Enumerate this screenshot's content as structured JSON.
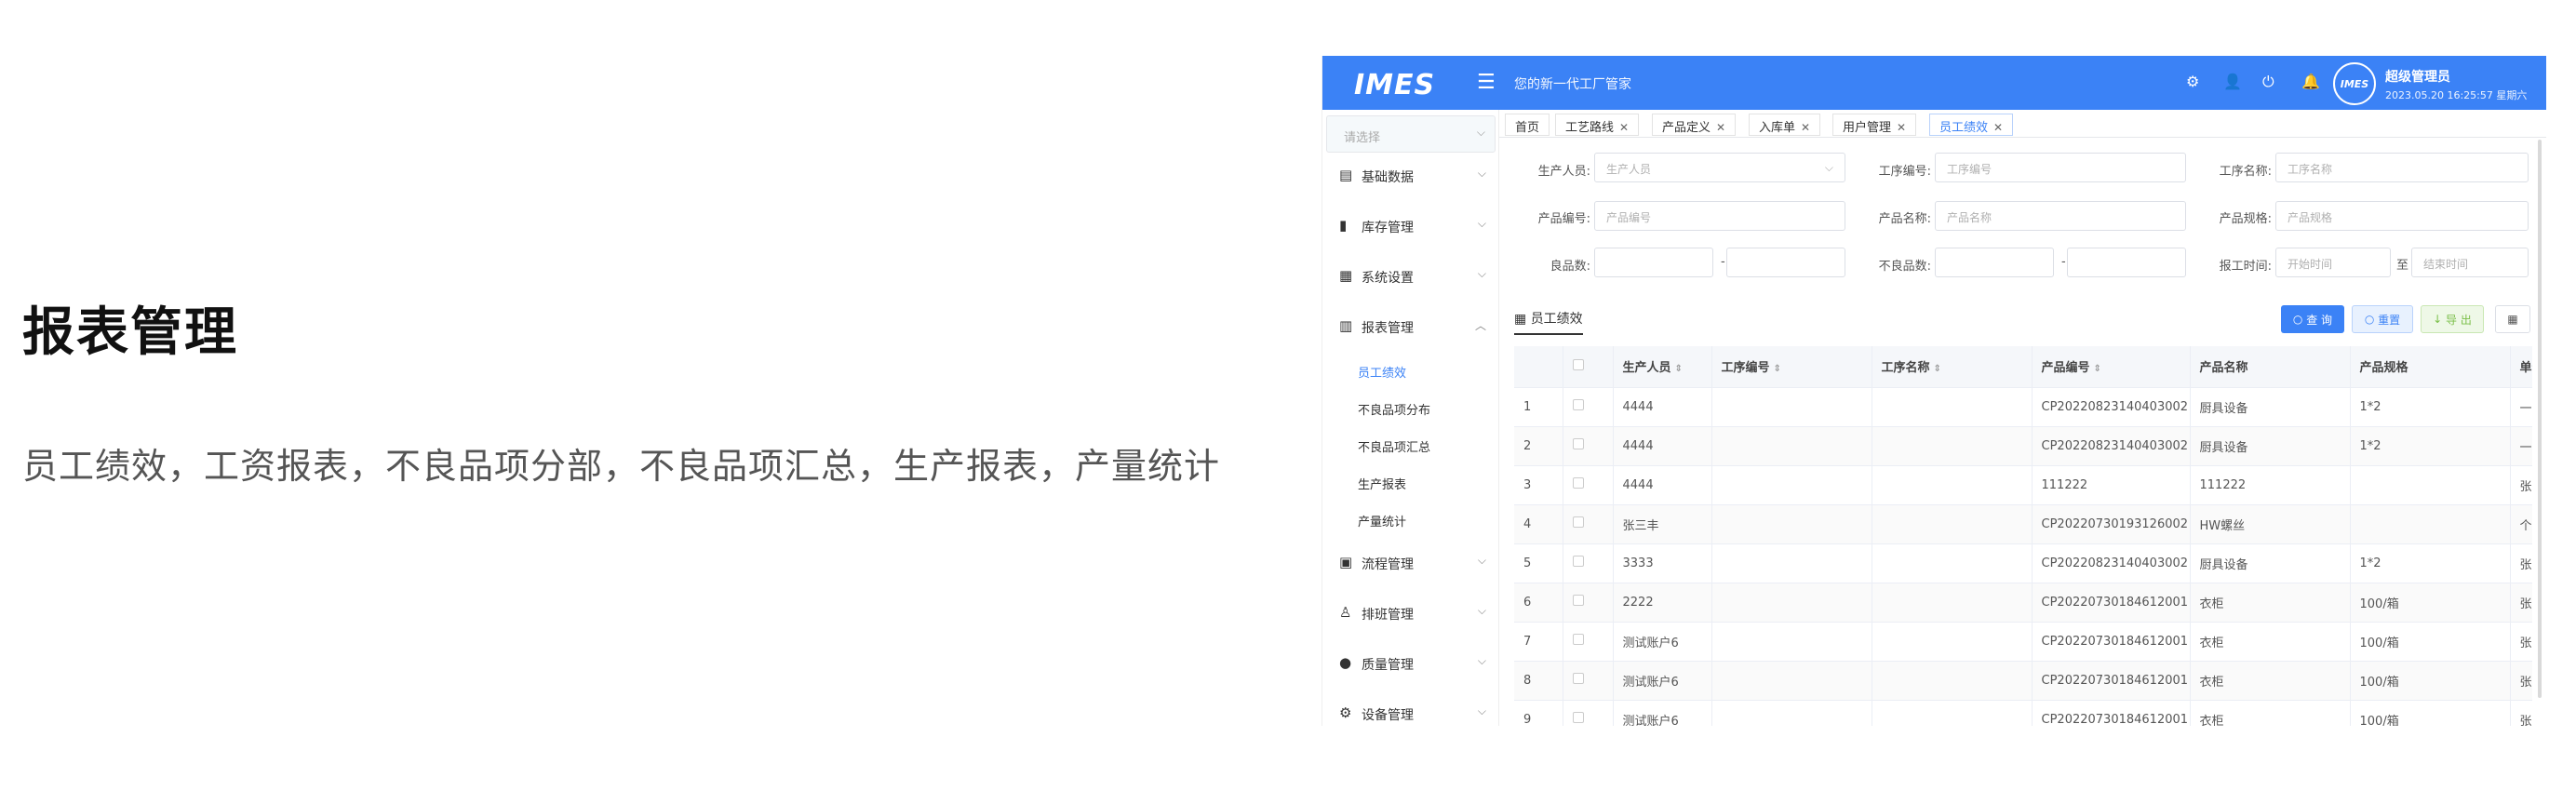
{
  "promo": {
    "title": "报表管理",
    "description": "员工绩效，工资报表，不良品项分部，不良品项汇总，生产报表，产量统计"
  },
  "header": {
    "logo": "IMES",
    "slogan": "您的新一代工厂管家",
    "username": "超级管理员",
    "datetime": "2023.05.20 16:25:57 星期六",
    "avatar_text": "IMES",
    "icons": [
      "settings-icon",
      "user-icon",
      "power-icon",
      "bell-icon"
    ],
    "accent_color": "#3b82f6"
  },
  "sidebar": {
    "select_placeholder": "请选择",
    "menu": [
      {
        "label": "基础数据",
        "icon": "book-icon"
      },
      {
        "label": "库存管理",
        "icon": "clipboard-icon"
      },
      {
        "label": "系统设置",
        "icon": "grid-icon"
      },
      {
        "label": "报表管理",
        "icon": "bar-chart-icon"
      },
      {
        "label": "流程管理",
        "icon": "flow-icon"
      },
      {
        "label": "排班管理",
        "icon": "person-icon"
      },
      {
        "label": "质量管理",
        "icon": "alert-icon"
      },
      {
        "label": "设备管理",
        "icon": "gear-icon"
      }
    ],
    "submenu": [
      "员工绩效",
      "不良品项分布",
      "不良品项汇总",
      "生产报表",
      "产量统计"
    ],
    "active_sub": "员工绩效"
  },
  "tabs": [
    "首页",
    "工艺路线",
    "产品定义",
    "入库单",
    "用户管理",
    "员工绩效"
  ],
  "filters": {
    "producer_label": "生产人员:",
    "producer_ph": "生产人员",
    "proc_no_label": "工序编号:",
    "proc_no_ph": "工序编号",
    "proc_name_label": "工序名称:",
    "proc_name_ph": "工序名称",
    "prod_no_label": "产品编号:",
    "prod_no_ph": "产品编号",
    "prod_name_label": "产品名称:",
    "prod_name_ph": "产品名称",
    "prod_spec_label": "产品规格:",
    "prod_spec_ph": "产品规格",
    "good_label": "良品数:",
    "bad_label": "不良品数:",
    "time_label": "报工时间:",
    "start_ph": "开始时间",
    "to": "至",
    "end_ph": "结束时间",
    "dash": "-"
  },
  "section_title": "员工绩效",
  "buttons": {
    "query": "查 询",
    "reset": "重置",
    "export": "导 出"
  },
  "table": {
    "columns": [
      "",
      "",
      "生产人员",
      "工序编号",
      "工序名称",
      "产品编号",
      "产品名称",
      "产品规格",
      "单位"
    ],
    "rows": [
      [
        "1",
        "4444",
        "",
        "",
        "CP20220823140403002",
        "厨具设备",
        "1*2",
        "一套"
      ],
      [
        "2",
        "4444",
        "",
        "",
        "CP20220823140403002",
        "厨具设备",
        "1*2",
        "一套"
      ],
      [
        "3",
        "4444",
        "",
        "",
        "111222",
        "111222",
        "",
        "张"
      ],
      [
        "4",
        "张三丰",
        "",
        "",
        "CP20220730193126002",
        "HW螺丝",
        "",
        "个"
      ],
      [
        "5",
        "3333",
        "",
        "",
        "CP20220823140403002",
        "厨具设备",
        "1*2",
        "张"
      ],
      [
        "6",
        "2222",
        "",
        "",
        "CP20220730184612001",
        "衣柜",
        "100/箱",
        "张"
      ],
      [
        "7",
        "测试账户6",
        "",
        "",
        "CP20220730184612001",
        "衣柜",
        "100/箱",
        "张"
      ],
      [
        "8",
        "测试账户6",
        "",
        "",
        "CP20220730184612001",
        "衣柜",
        "100/箱",
        "张"
      ],
      [
        "9",
        "测试账户6",
        "",
        "",
        "CP20220730184612001",
        "衣柜",
        "100/箱",
        "张"
      ]
    ]
  }
}
